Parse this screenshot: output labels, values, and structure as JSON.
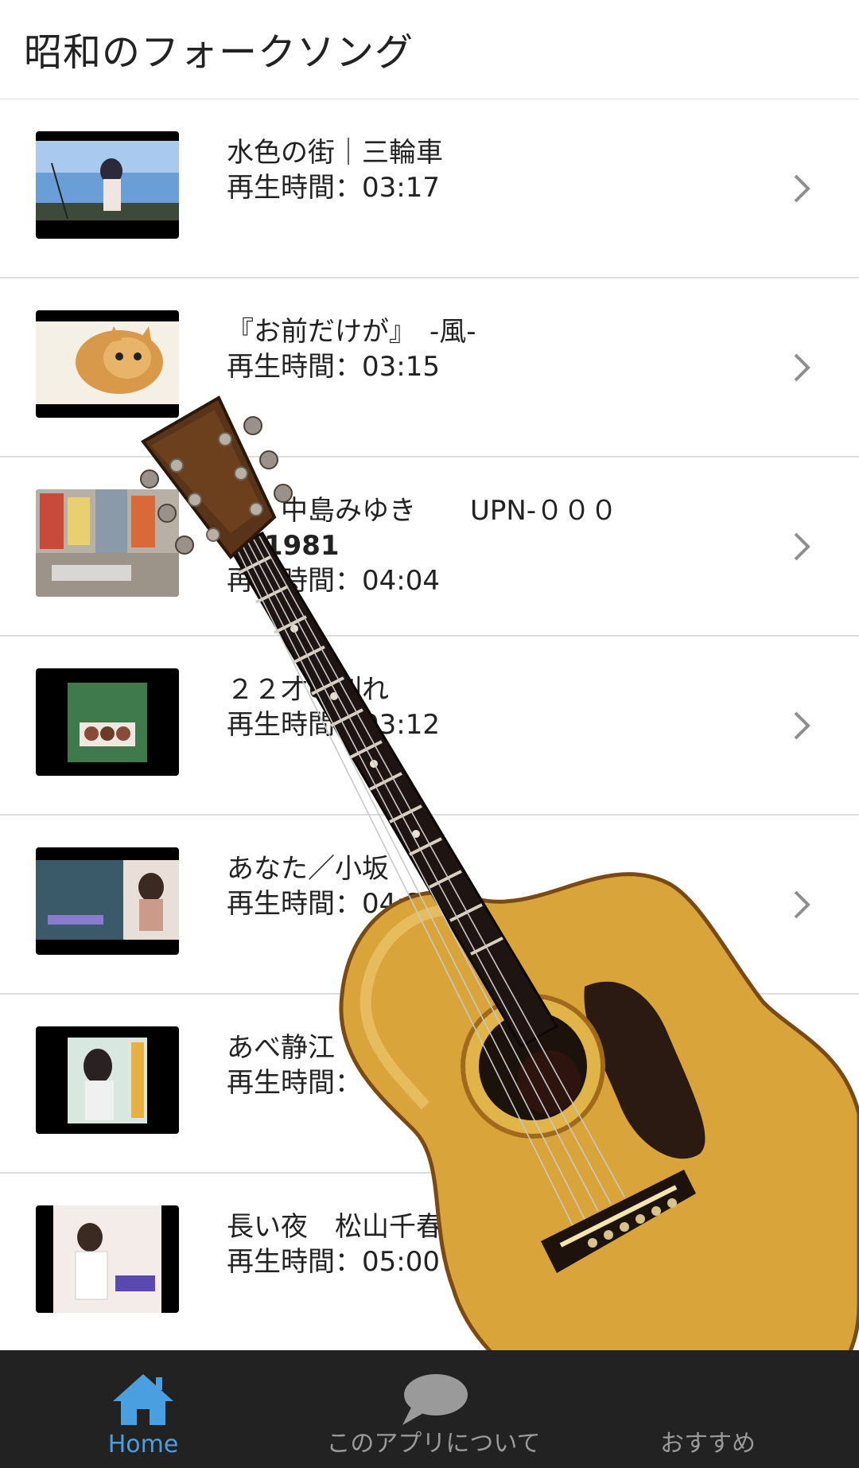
{
  "header": {
    "title": "昭和のフォークソング"
  },
  "songs": [
    {
      "title": "水色の街｜三輪車",
      "title2": "",
      "duration": "再生時間：03:17"
    },
    {
      "title": "『お前だけが』　-風-",
      "title2": "",
      "duration": "再生時間：03:15"
    },
    {
      "title": "　　中島みゆき　　UPN-０００",
      "title2": "　’1981",
      "duration": "再生時間：04:04"
    },
    {
      "title": "２２才の別れ",
      "title2": "",
      "duration": "再生時間：03:12"
    },
    {
      "title": "あなた／小坂",
      "title2": "",
      "duration": "再生時間：04:3"
    },
    {
      "title": "あべ静江",
      "title2": "",
      "duration": "再生時間："
    },
    {
      "title": "長い夜　松山千春",
      "title2": "",
      "duration": "再生時間：05:00"
    }
  ],
  "tabs": [
    {
      "label": "Home",
      "icon": "home-icon"
    },
    {
      "label": "このアプリについて",
      "icon": "chat-bubble-icon"
    },
    {
      "label": "おすすめ",
      "icon": "star-icon"
    }
  ],
  "colors": {
    "accent": "#4a9fe0",
    "tabbar": "#222222",
    "guitar_body": "#d9a53a"
  }
}
